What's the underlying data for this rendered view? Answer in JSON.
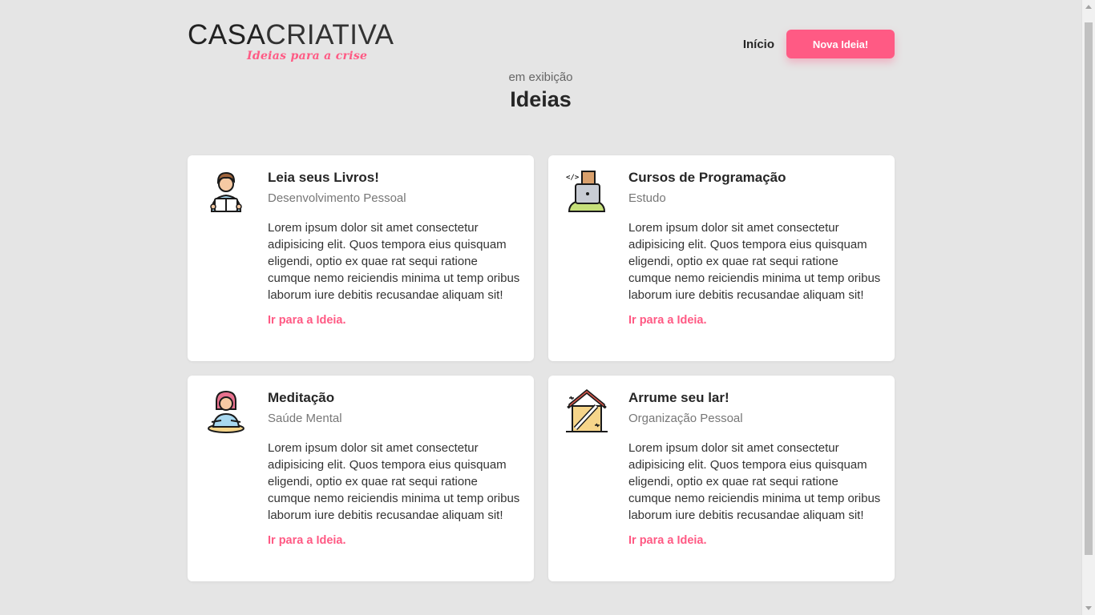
{
  "brand": {
    "name_bold": "CASA",
    "name_light": "CRIATIVA",
    "tagline": "Ideias para a crise",
    "accent_color": "#ff5a84"
  },
  "nav": {
    "home_label": "Início",
    "new_idea_label": "Nova Ideia!"
  },
  "section": {
    "subtitle": "em exibição",
    "title": "Ideias"
  },
  "ideas": [
    {
      "icon": "reading-person-icon",
      "title": "Leia seus Livros!",
      "category": "Desenvolvimento Pessoal",
      "description": "Lorem ipsum dolor sit amet consectetur adipisicing elit. Quos tempora eius quisquam eligendi, optio ex quae rat sequi ratione cumque nemo reiciendis minima ut temp oribus laborum iure debitis recusandae aliquam sit!",
      "link_label": "Ir para a Ideia."
    },
    {
      "icon": "programmer-icon",
      "title": "Cursos de Programação",
      "category": "Estudo",
      "description": "Lorem ipsum dolor sit amet consectetur adipisicing elit. Quos tempora eius quisquam eligendi, optio ex quae rat sequi ratione cumque nemo reiciendis minima ut temp oribus laborum iure debitis recusandae aliquam sit!",
      "link_label": "Ir para a Ideia."
    },
    {
      "icon": "meditation-icon",
      "title": "Meditação",
      "category": "Saúde Mental",
      "description": "Lorem ipsum dolor sit amet consectetur adipisicing elit. Quos tempora eius quisquam eligendi, optio ex quae rat sequi ratione cumque nemo reiciendis minima ut temp oribus laborum iure debitis recusandae aliquam sit!",
      "link_label": "Ir para a Ideia."
    },
    {
      "icon": "house-cleaning-icon",
      "title": "Arrume seu lar!",
      "category": "Organização Pessoal",
      "description": "Lorem ipsum dolor sit amet consectetur adipisicing elit. Quos tempora eius quisquam eligendi, optio ex quae rat sequi ratione cumque nemo reiciendis minima ut temp oribus laborum iure debitis recusandae aliquam sit!",
      "link_label": "Ir para a Ideia."
    }
  ]
}
